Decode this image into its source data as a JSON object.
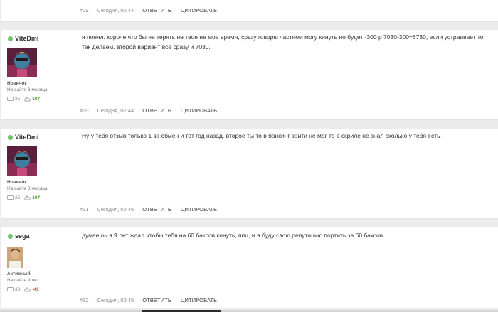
{
  "posts": [
    {
      "number": "#29",
      "date": "Сегодня, 02:44",
      "reply_label": "ОТВЕТИТЬ",
      "quote_label": "ЦИТИРОВАТЬ"
    },
    {
      "author": "ViteDmi",
      "rank": "Новичок",
      "since": "На сайте 3 месяца",
      "messages": "25",
      "reputation": "107",
      "text": "я понял. короче что бы не терять не твое не мое время, сразу говорю частями могу кинуть но будет -300 р 7030-300=6730,   если устраивает то так делаем. второй вариант все сразу и 7030.",
      "number": "#30",
      "date": "Сегодня, 02:44",
      "reply_label": "ОТВЕТИТЬ",
      "quote_label": "ЦИТИРОВАТЬ"
    },
    {
      "author": "ViteDmi",
      "rank": "Новичок",
      "since": "На сайте 3 месяца",
      "messages": "25",
      "reputation": "107",
      "text": "Ну у тебя отзыв только 1 за обмен и тот год назад. второе ты то в банкинг зайти не мог то в скриле не знал сколько у тебя есть .",
      "number": "#31",
      "date": "Сегодня, 02:45",
      "reply_label": "ОТВЕТИТЬ",
      "quote_label": "ЦИТИРОВАТЬ"
    },
    {
      "author": "sega",
      "rank": "Активный",
      "since": "На сайте 9 лет",
      "messages": "33",
      "reputation": "-41",
      "text": "думаешь я 9 лет ждал чтобы тебя на 60 баксов кинуть, ппц, и я буду свою репутацию портить за 60 баксов",
      "number": "#32",
      "date": "Сегодня, 02:46",
      "reply_label": "ОТВЕТИТЬ",
      "quote_label": "ЦИТИРОВАТЬ"
    }
  ],
  "colors": {
    "online": "#6fc46b",
    "rep_positive": "#4c9a2a",
    "rep_negative": "#d03b3b",
    "page_bg": "#ebebeb"
  },
  "icons": [
    "message-icon",
    "reputation-icon",
    "online-dot-icon"
  ]
}
